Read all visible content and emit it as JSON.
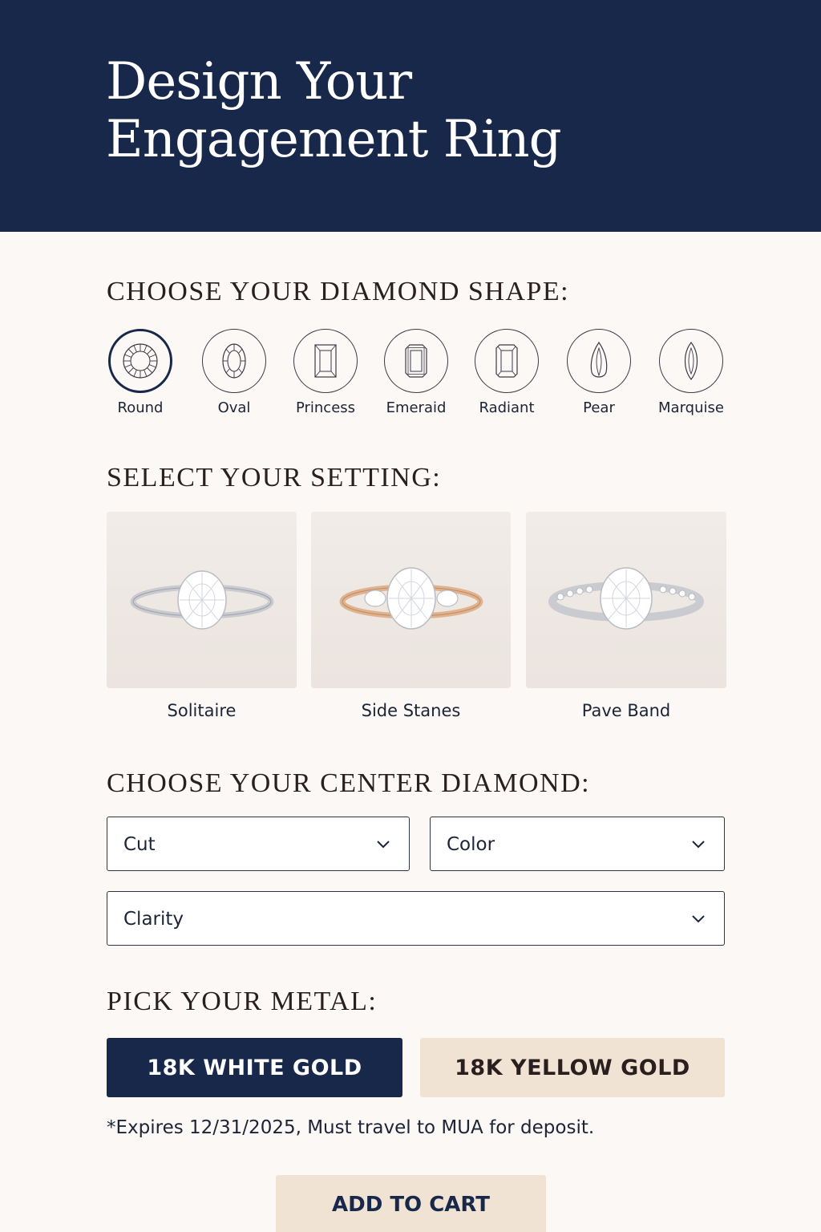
{
  "header": {
    "title": "Design Your Engagement Ring"
  },
  "shape_section": {
    "title": "CHOOSE YOUR DIAMOND SHAPE:",
    "shapes": [
      {
        "label": "Round",
        "icon": "round-diamond-icon",
        "selected": true
      },
      {
        "label": "Oval",
        "icon": "oval-diamond-icon",
        "selected": false
      },
      {
        "label": "Princess",
        "icon": "princess-diamond-icon",
        "selected": false
      },
      {
        "label": "Emeraid",
        "icon": "emerald-diamond-icon",
        "selected": false
      },
      {
        "label": "Radiant",
        "icon": "radiant-diamond-icon",
        "selected": false
      },
      {
        "label": "Pear",
        "icon": "pear-diamond-icon",
        "selected": false
      },
      {
        "label": "Marquise",
        "icon": "marquise-diamond-icon",
        "selected": false
      }
    ]
  },
  "setting_section": {
    "title": "SELECT YOUR SETTING:",
    "settings": [
      {
        "label": "Solitaire",
        "band_color": "#c9cbd0"
      },
      {
        "label": "Side Stanes",
        "band_color": "#e0b38f"
      },
      {
        "label": "Pave Band",
        "band_color": "#c9cbd0"
      }
    ]
  },
  "diamond_section": {
    "title": "CHOOSE YOUR CENTER DIAMOND:",
    "cut": {
      "value": "Cut"
    },
    "color": {
      "value": "Color"
    },
    "clarity": {
      "value": "Clarity"
    }
  },
  "metal_section": {
    "title": "PICK YOUR METAL:",
    "white_gold_label": "18K WHITE GOLD",
    "yellow_gold_label": "18K YELLOW GOLD",
    "selected": "18K WHITE GOLD"
  },
  "note": "*Expires 12/31/2025, Must travel to MUA for deposit.",
  "cart": {
    "label": "ADD TO CART"
  },
  "colors": {
    "navy": "#18284a",
    "cream": "#fbf8f5",
    "sand": "#f1e3d3"
  }
}
